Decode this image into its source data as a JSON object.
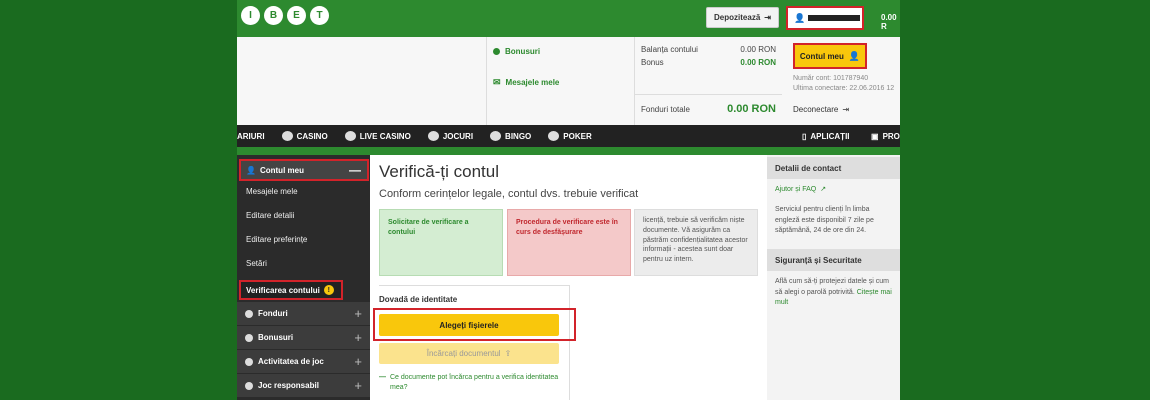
{
  "header": {
    "logo_letters": [
      "I",
      "B",
      "E",
      "T"
    ],
    "deposit_label": "Depozitează",
    "balance": "0.00 R"
  },
  "panel": {
    "bonuses_label": "Bonusuri",
    "messages_label": "Mesajele mele",
    "balance_label": "Balanța contului",
    "balance_value": "0.00 RON",
    "bonus_label": "Bonus",
    "bonus_value": "0.00 RON",
    "total_label": "Fonduri totale",
    "total_value": "0.00 RON",
    "account_button": "Contul meu",
    "account_number": "Număr cont: 101787940",
    "last_login": "Ultima conectare: 22.06.2016 12",
    "logout_label": "Deconectare"
  },
  "nav": {
    "items": [
      "ARIURI",
      "CASINO",
      "LIVE CASINO",
      "JOCURI",
      "BINGO",
      "POKER"
    ],
    "apps_label": "APLICAȚII",
    "promo_label": "PRO"
  },
  "sidebar": {
    "header": "Contul meu",
    "items": [
      "Mesajele mele",
      "Editare detalii",
      "Editare preferințe",
      "Setări"
    ],
    "active": "Verificarea contului",
    "groups": [
      "Fonduri",
      "Bonusuri",
      "Activitatea de joc",
      "Joc responsabil"
    ]
  },
  "main": {
    "title": "Verifică-ți contul",
    "subtitle": "Conform cerințelor legale, contul dvs. trebuie verificat",
    "step1": "Solicitare de verificare a contului",
    "step2": "Procedura de verificare este în curs de desfășurare",
    "info": "licență, trebuie să verificăm niște documente. Vă asigurăm ca păstrăm confidențialitatea acestor informații - acestea sunt doar pentru uz intern.",
    "proof_label": "Dovadă de identitate",
    "choose_files": "Alegeți fișierele",
    "upload_label": "Încărcați documentul",
    "help_link": "Ce documente pot încărca pentru a verifica identitatea mea?"
  },
  "right": {
    "contact_title": "Detalii de contact",
    "faq_link": "Ajutor și FAQ",
    "contact_text": "Serviciul pentru clienți în limba engleză este disponibil 7 zile pe săptămână, 24 de ore din 24.",
    "security_title": "Siguranță și Securitate",
    "security_text": "Află cum să-ți protejezi datele și cum să alegi o parolă potrivită.",
    "read_more": "Citește mai mult"
  },
  "colors": {
    "brand_green": "#2d8a2f",
    "accent_yellow": "#f9c70c",
    "highlight_red": "#d2232a"
  }
}
